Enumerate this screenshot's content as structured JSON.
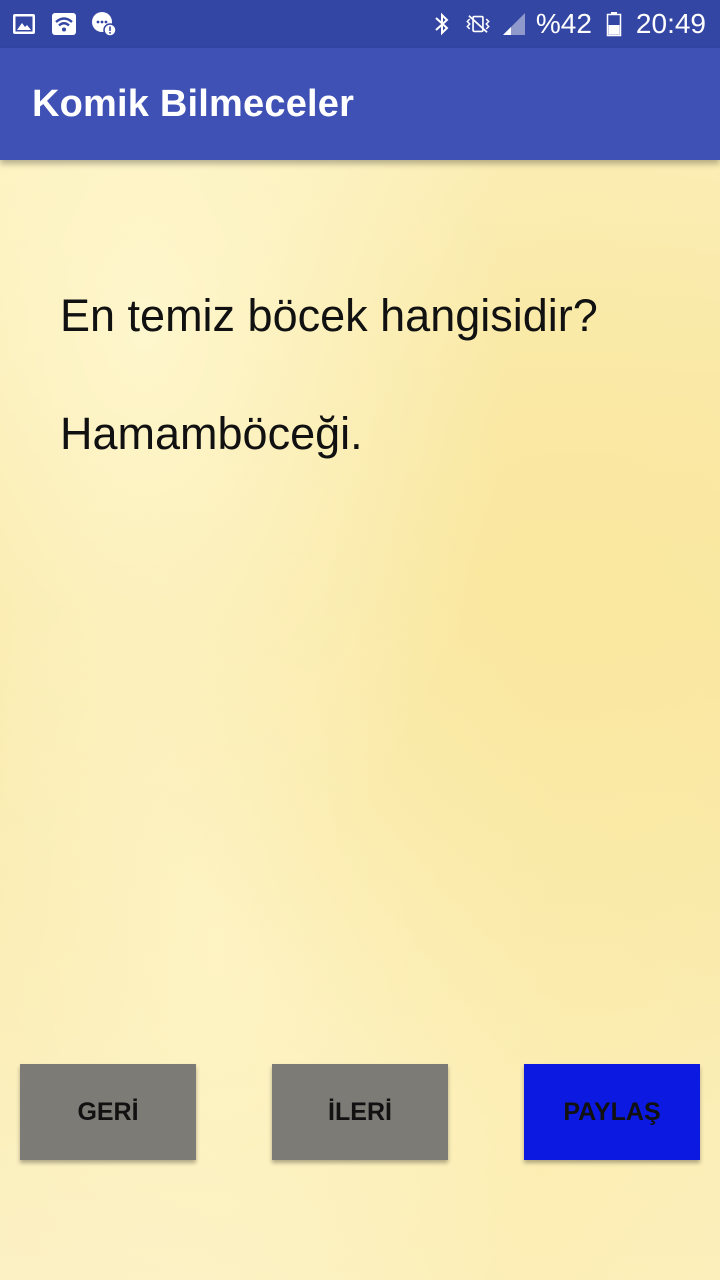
{
  "status_bar": {
    "battery": "%42",
    "time": "20:49",
    "icons_left": [
      "gallery-icon",
      "wifi-icon",
      "chat-alert-icon"
    ],
    "icons_right": [
      "bluetooth-icon",
      "vibrate-icon",
      "signal-icon",
      "battery-icon"
    ]
  },
  "app_bar": {
    "title": "Komik Bilmeceler"
  },
  "riddle": {
    "question": "En temiz böcek hangisidir?",
    "answer": "Hamamböceği."
  },
  "buttons": {
    "back": "GERİ",
    "next": "İLERİ",
    "share": "PAYLAŞ"
  },
  "colors": {
    "status_bar": "#3446a3",
    "app_bar": "#3f51b5",
    "button_gray": "#7d7b76",
    "button_share": "#0c19e0",
    "background": "#f6e7a8"
  }
}
